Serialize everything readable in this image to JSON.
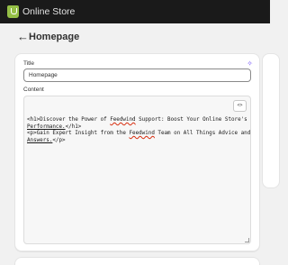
{
  "topbar": {
    "logo_icon": "shopify-bag-icon",
    "store_name": "Online Store"
  },
  "header": {
    "back_icon": "arrow-left-icon",
    "title": "Homepage"
  },
  "form": {
    "title_label": "Title",
    "title_value": "Homepage",
    "magic_icon": "sparkle-icon",
    "content_label": "Content",
    "code_toggle_label": "<>",
    "content_lines": [
      {
        "line1": "<h1>Discover the Power of ",
        "spell1": "Feedwind",
        "line1b": " Support: Boost Your Online Store's",
        "line2": "Performance.",
        "line2b": "</h1>"
      },
      {
        "line1": "<p>Gain Expert Insight from the ",
        "spell1": "Feedwind",
        "line1b": " Team on All Things Advice and",
        "line2": "Answers.",
        "line2b": "</p>"
      }
    ]
  },
  "colors": {
    "topbar_bg": "#1a1a1a",
    "page_bg": "#f1f1f1",
    "logo_green": "#95bf47",
    "accent_purple": "#7a5af8",
    "spellcheck_red": "#d72c0d"
  }
}
